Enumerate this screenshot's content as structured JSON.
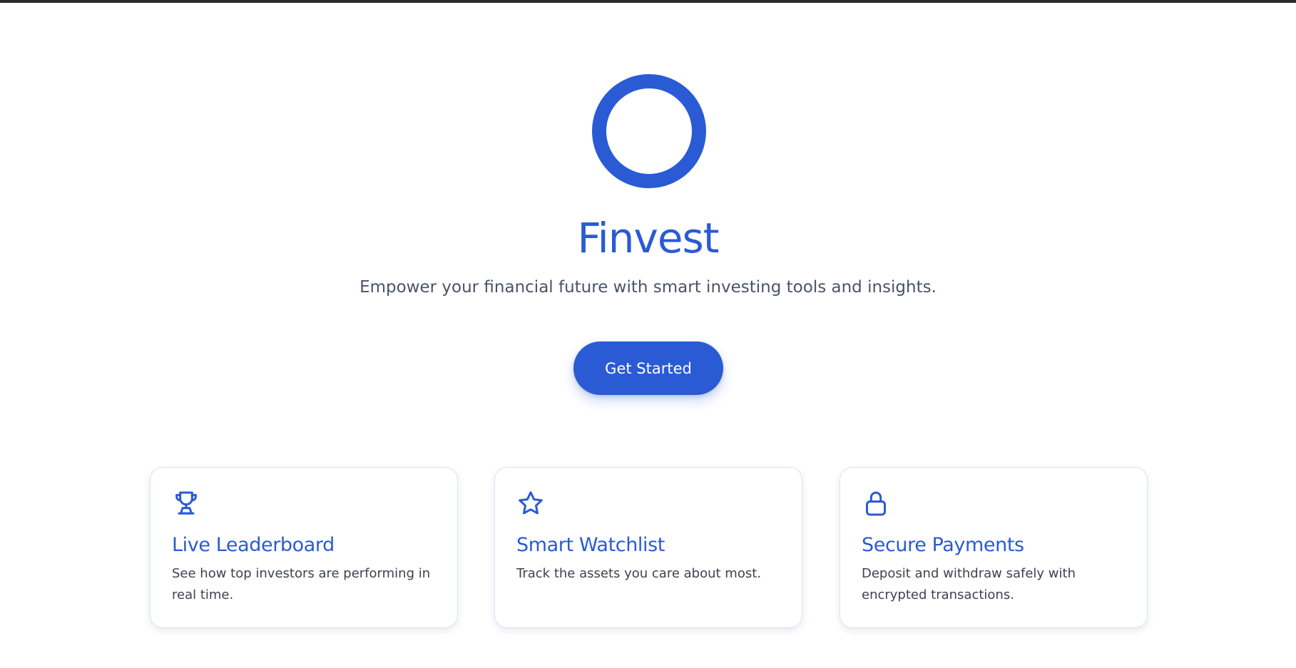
{
  "brand": {
    "name": "Finvest",
    "tagline": "Empower your financial future with smart investing tools and insights.",
    "accent_color": "#2a5bd4",
    "logo_icon": "ring-logo-icon"
  },
  "hero": {
    "cta_label": "Get Started"
  },
  "features": [
    {
      "icon": "trophy-icon",
      "title": "Live Leaderboard",
      "description": "See how top investors are performing in real time."
    },
    {
      "icon": "star-icon",
      "title": "Smart Watchlist",
      "description": "Track the assets you care about most."
    },
    {
      "icon": "lock-icon",
      "title": "Secure Payments",
      "description": "Deposit and withdraw safely with encrypted transactions."
    }
  ]
}
